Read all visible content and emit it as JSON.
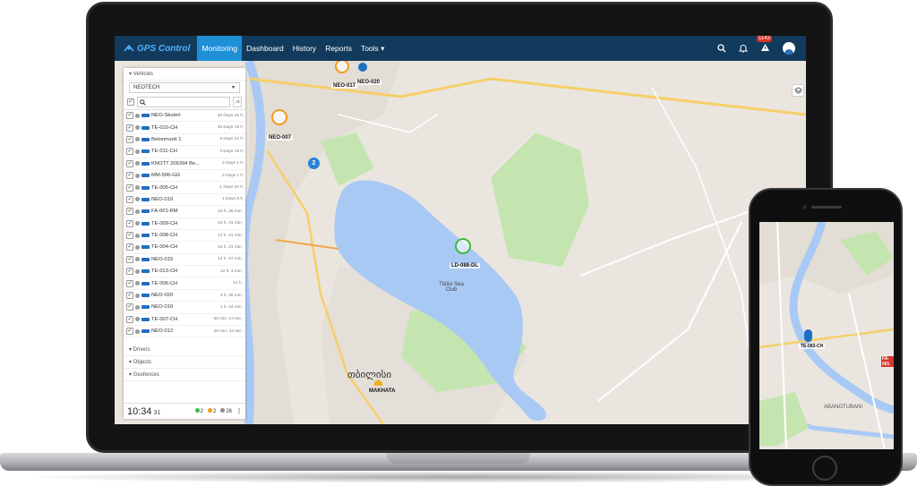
{
  "app": {
    "logo_text": "GPS Control",
    "brand_color": "#4db3ff",
    "topbar_color": "#123a5c",
    "active_color": "#1f8fd6"
  },
  "nav": {
    "items": [
      {
        "label": "Monitoring",
        "active": true
      },
      {
        "label": "Dashboard",
        "active": false
      },
      {
        "label": "History",
        "active": false
      },
      {
        "label": "Reports",
        "active": false
      },
      {
        "label": "Tools ▾",
        "active": false
      }
    ],
    "notification_count": "1143",
    "icons": [
      "search-icon",
      "bell-icon",
      "warning-icon",
      "user-avatar-icon"
    ]
  },
  "sidebar": {
    "vehicles_header": "▾ Vehicles",
    "group_select": "NEOTECH",
    "vehicles": [
      {
        "name": "NEO-Skuteri",
        "time": "20 Days 21 h"
      },
      {
        "name": "TE-010-CH",
        "time": "15 Days 19 h"
      },
      {
        "name": "Betonmzeli 1",
        "time": "8 Days 22 h"
      },
      {
        "name": "TE-011-CH",
        "time": "3 Days 19 h"
      },
      {
        "name": "KNOTT 206394 Be...",
        "time": "2 Days 1 h"
      },
      {
        "name": "MM-506-GG",
        "time": "2 Days 1 h"
      },
      {
        "name": "TE-005-CH",
        "time": "1 Days 20 h"
      },
      {
        "name": "NEO-010",
        "time": "1 Days 6 h"
      },
      {
        "name": "FA-001-RM",
        "time": "23 h. 28 min."
      },
      {
        "name": "TE-009-CH",
        "time": "19 h. 41 min."
      },
      {
        "name": "TE-008-CH",
        "time": "17 h. 41 min."
      },
      {
        "name": "TE-004-CH",
        "time": "16 h. 31 min."
      },
      {
        "name": "NEO-015",
        "time": "14 h. 27 min."
      },
      {
        "name": "TE-013-CH",
        "time": "12 h. 3 min."
      },
      {
        "name": "TE-006-CH",
        "time": "12 h."
      },
      {
        "name": "NEO-020",
        "time": "3 h. 46 min."
      },
      {
        "name": "NEO-016",
        "time": "1 h. 44 min."
      },
      {
        "name": "TE-007-CH",
        "time": "58 min. 14 sec."
      },
      {
        "name": "NEO-012",
        "time": "49 min. 44 sec."
      }
    ],
    "drivers_header": "▾ Drivers",
    "objects_header": "▾ Objects",
    "geofences_header": "▾ Geofences",
    "clock": "10:34",
    "clock_seconds": "31",
    "counts": {
      "green": "2",
      "orange": "2",
      "gray": "26"
    },
    "count_colors": {
      "green": "#3dbb3d",
      "orange": "#f39a1e",
      "gray": "#8c8c8c"
    }
  },
  "map": {
    "water_color": "#a9c9f5",
    "park_color": "#c5e5b0",
    "markers": [
      {
        "label": "NEO-017"
      },
      {
        "label": "NEO-020"
      },
      {
        "label": "NEO-007"
      },
      {
        "label": "LD-088-DL"
      }
    ],
    "cluster_count": "2",
    "places": {
      "tbilisi_sea_club": "Tbilisi Sea Club",
      "city_name": "თბილისი",
      "makhata": "MAKHATA"
    }
  },
  "phone": {
    "marker_label": "TE-083-CH",
    "side_label": "FA-001",
    "district": "ABANOTUBANI"
  }
}
